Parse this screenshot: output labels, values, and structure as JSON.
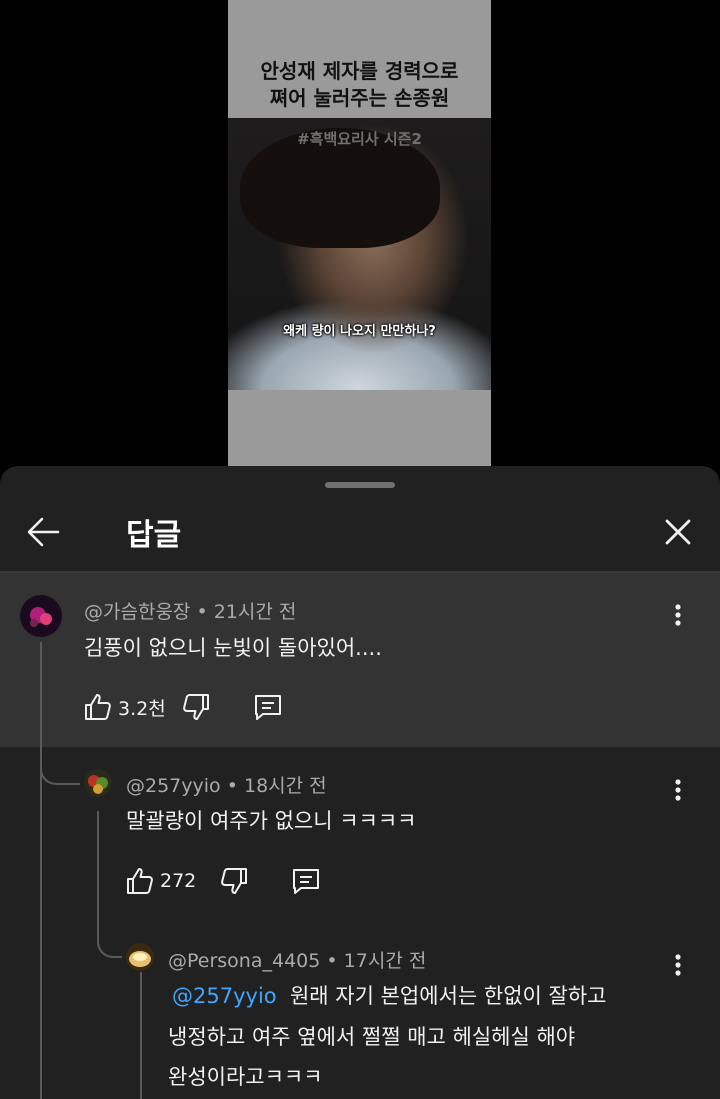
{
  "video": {
    "title_line1": "안성재 제자를 경력으로",
    "title_line2": "쪄어 눌러주는 손종원",
    "hashtag": "#흑백요리사 시즌2",
    "caption": "왜케 량이 나오지 만만하나?"
  },
  "sheet": {
    "title": "답글"
  },
  "comments": [
    {
      "author": "@가슴한웅장",
      "time": "21시간 전",
      "text": "김풍이 없으니 눈빛이 돌아있어....",
      "likes": "3.2천"
    },
    {
      "author": "@257yyio",
      "time": "18시간 전",
      "text": "말괄량이 여주가 없으니 ㅋㅋㅋㅋ",
      "likes": "272"
    },
    {
      "author": "@Persona_4405",
      "time": "17시간 전",
      "mention": "@257yyio",
      "text_line1": "원래 자기 본업에서는 한없이 잘하고",
      "text_line2": "냉정하고 여주 옆에서 쩔쩔 매고 헤실헤실 해야",
      "text_line3": "완성이라고ㅋㅋㅋ"
    }
  ],
  "separator": "•",
  "colors": {
    "sheet_bg": "#212121",
    "highlight_bg": "#333333",
    "mention": "#3ea6ff",
    "meta_text": "#aaaaaa"
  },
  "icons": [
    "back-arrow-icon",
    "close-icon",
    "more-vert-icon",
    "thumb-up-icon",
    "thumb-down-icon",
    "reply-icon"
  ]
}
